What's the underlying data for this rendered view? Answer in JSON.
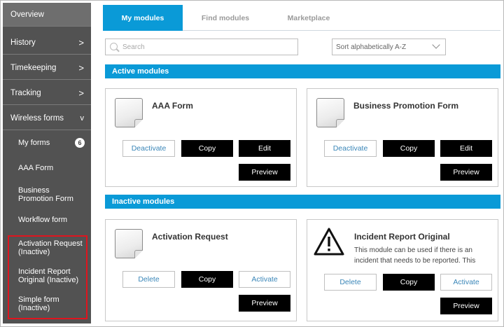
{
  "sidebar": {
    "items": [
      {
        "label": "Overview"
      },
      {
        "label": "History"
      },
      {
        "label": "Timekeeping"
      },
      {
        "label": "Tracking"
      },
      {
        "label": "Wireless forms"
      }
    ],
    "chevrons": {
      "right": ">",
      "down": "v"
    },
    "sub_items": [
      {
        "label": "My forms",
        "badge": "6"
      },
      {
        "label": "AAA Form"
      },
      {
        "label": "Business Promotion Form"
      },
      {
        "label": "Workflow form"
      },
      {
        "label": "Activation Request (Inactive)"
      },
      {
        "label": "Incident Report Original (Inactive)"
      },
      {
        "label": "Simple form (Inactive)"
      }
    ],
    "highlight_color": "#e0141e"
  },
  "tabs": [
    {
      "label": "My modules",
      "active": true
    },
    {
      "label": "Find modules",
      "active": false
    },
    {
      "label": "Marketplace",
      "active": false
    }
  ],
  "search": {
    "placeholder": "Search"
  },
  "sort": {
    "value": "Sort alphabetically A-Z"
  },
  "sections": {
    "active": {
      "title": "Active modules"
    },
    "inactive": {
      "title": "Inactive modules"
    }
  },
  "active_cards": [
    {
      "title": "AAA Form",
      "icon": "document-icon",
      "buttons": {
        "deactivate": "Deactivate",
        "copy": "Copy",
        "edit": "Edit",
        "preview": "Preview"
      }
    },
    {
      "title": "Business Promotion Form",
      "icon": "document-icon",
      "buttons": {
        "deactivate": "Deactivate",
        "copy": "Copy",
        "edit": "Edit",
        "preview": "Preview"
      }
    }
  ],
  "inactive_cards": [
    {
      "title": "Activation Request",
      "icon": "document-icon",
      "buttons": {
        "delete": "Delete",
        "copy": "Copy",
        "activate": "Activate",
        "preview": "Preview"
      }
    },
    {
      "title": "Incident Report Original",
      "icon": "warning-icon",
      "description": "This module can be used if there is an incident that needs to be reported. This",
      "buttons": {
        "delete": "Delete",
        "copy": "Copy",
        "activate": "Activate",
        "preview": "Preview"
      }
    }
  ],
  "colors": {
    "accent": "#0a9ad7",
    "sidebar": "#525252",
    "button_dark": "#000000",
    "link": "#3a86b8"
  }
}
